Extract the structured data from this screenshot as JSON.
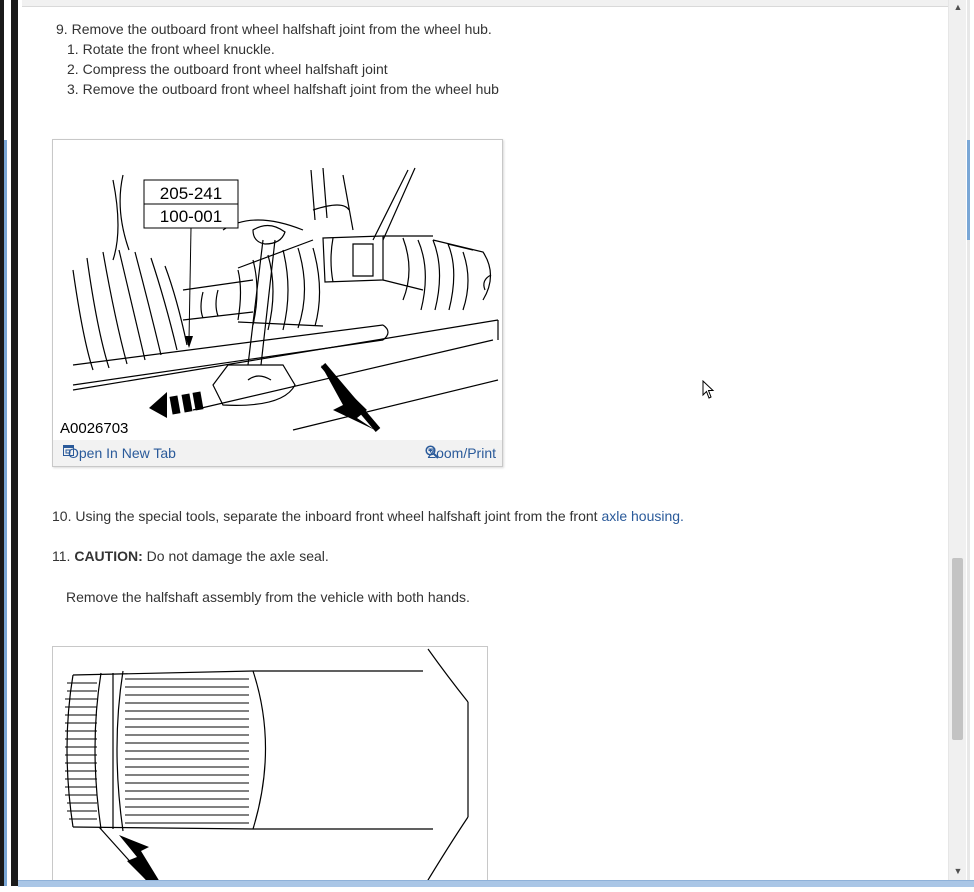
{
  "steps": {
    "step9": {
      "number": "9.",
      "text": "Remove the outboard front wheel halfshaft joint from the wheel hub.",
      "substeps": [
        {
          "number": "1.",
          "text": "Rotate the front wheel knuckle."
        },
        {
          "number": "2.",
          "text": "Compress the outboard front wheel halfshaft joint"
        },
        {
          "number": "3.",
          "text": "Remove the outboard front wheel halfshaft joint from the wheel hub"
        }
      ]
    },
    "step10": {
      "number": "10.",
      "text": "Using the special tools, separate the inboard front wheel halfshaft joint from the front",
      "link": "axle housing."
    },
    "step11": {
      "number": "11.",
      "caution_label": "CAUTION:",
      "caution_text": "Do not damage the axle seal.",
      "text": "Remove the halfshaft assembly from the vehicle with both hands."
    }
  },
  "figure1": {
    "tool_number_1": "205-241",
    "tool_number_2": "100-001",
    "image_id": "A0026703",
    "open_tab_label": "Open In New Tab",
    "zoom_label": "Zoom/Print"
  },
  "icons": {
    "open_tab": "open-in-new-tab-icon",
    "zoom": "magnifier-zoom-icon",
    "scroll_up": "▲",
    "scroll_down": "▼"
  },
  "colors": {
    "link": "#2a5a9a",
    "text": "#333333",
    "toolbar_bg": "#f2f2f2"
  }
}
